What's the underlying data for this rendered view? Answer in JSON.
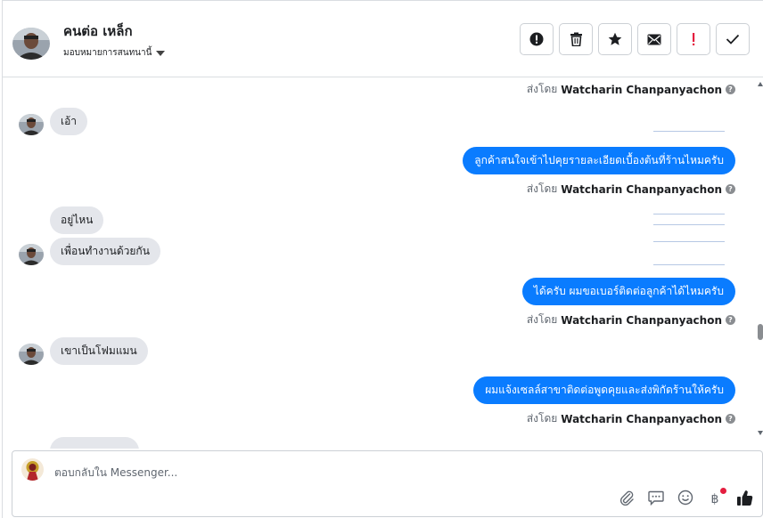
{
  "header": {
    "contact_name": "คนต่อ เหล็ก",
    "assign_label": "มอบหมายการสนทนานี้",
    "actions": [
      {
        "icon": "alert-circle-icon",
        "name": "mark-spam-button"
      },
      {
        "icon": "trash-icon",
        "name": "delete-button"
      },
      {
        "icon": "star-icon",
        "name": "star-button"
      },
      {
        "icon": "envelope-icon",
        "name": "mark-unread-button"
      },
      {
        "icon": "exclamation-icon",
        "name": "follow-up-button"
      },
      {
        "icon": "checkmark-icon",
        "name": "mark-done-button"
      }
    ]
  },
  "messages": {
    "sent_prefix": "ส่งโดย",
    "sender_name": "Watcharin Chanpanyachon",
    "info_glyph": "?",
    "in_1": "เอ้า",
    "out_1": "ลูกค้าสนใจเข้าไปคุยรายละเอียดเบื้องต้นที่ร้านไหมครับ",
    "in_2": "อยู่ไหน",
    "in_3": "เพื่อนทำงานด้วยกัน",
    "out_2": "ได้ครับ ผมขอเบอร์ติดต่อลูกค้าได้ไหมครับ",
    "in_4": "เขาเป็นโฟมแมน",
    "out_3": "ผมแจ้งเซลล์สาขาติดต่อพูดคุยและส่งพิกัดร้านให้ครับ"
  },
  "composer": {
    "placeholder": "ตอบกลับใน Messenger...",
    "baht_glyph": "฿"
  },
  "colors": {
    "outgoing_bubble": "#0a7cff",
    "incoming_bubble": "#e4e6eb",
    "like_icon": "#1c1e21",
    "follow_up_icon": "#e41e3f"
  }
}
